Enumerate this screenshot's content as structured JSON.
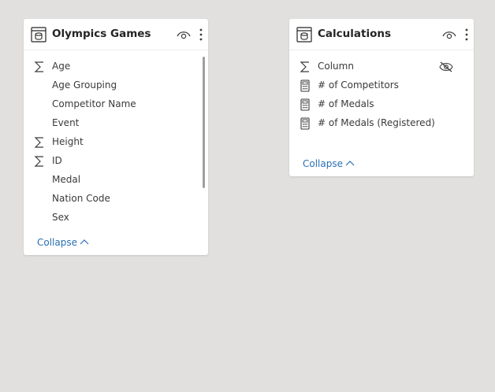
{
  "tables": [
    {
      "title": "Olympics Games",
      "fields": [
        {
          "name": "Age",
          "icon": "sigma-icon"
        },
        {
          "name": "Age Grouping",
          "icon": ""
        },
        {
          "name": "Competitor Name",
          "icon": ""
        },
        {
          "name": "Event",
          "icon": ""
        },
        {
          "name": "Height",
          "icon": "sigma-icon"
        },
        {
          "name": "ID",
          "icon": "sigma-icon"
        },
        {
          "name": "Medal",
          "icon": ""
        },
        {
          "name": "Nation Code",
          "icon": ""
        },
        {
          "name": "Sex",
          "icon": ""
        }
      ],
      "collapse_label": "Collapse"
    },
    {
      "title": "Calculations",
      "fields": [
        {
          "name": "Column",
          "icon": "sigma-icon",
          "hidden": true
        },
        {
          "name": "# of Competitors",
          "icon": "calculator-icon"
        },
        {
          "name": "# of Medals",
          "icon": "calculator-icon"
        },
        {
          "name": "# of Medals (Registered)",
          "icon": "calculator-icon"
        }
      ],
      "collapse_label": "Collapse"
    }
  ],
  "colors": {
    "canvas": "#e1e0de",
    "card": "#ffffff",
    "text": "#3b3a39",
    "link": "#2a6fb3"
  }
}
